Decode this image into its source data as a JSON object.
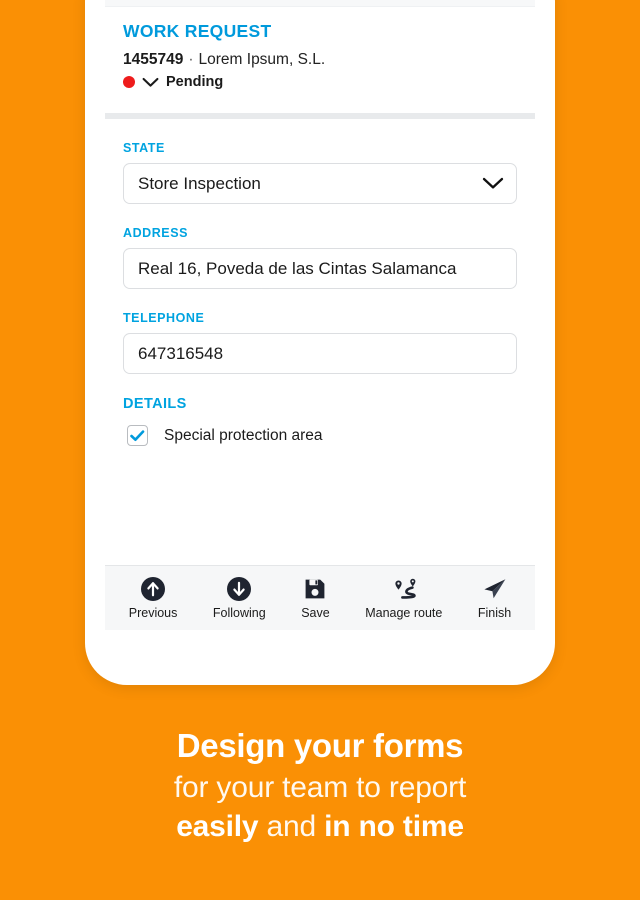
{
  "theme": {
    "background_orange": "#FA9005",
    "accent_blue": "#00A3E0",
    "status_red": "#EE1C1C",
    "text_dark": "#1b1b1b"
  },
  "screen": {
    "header": {
      "title": "WORK REQUEST",
      "reference_id": "1455749",
      "separator": "·",
      "company": "Lorem Ipsum, S.L.",
      "status": "Pending"
    },
    "form": {
      "fields": [
        {
          "label": "STATE",
          "value": "Store Inspection",
          "type": "select"
        },
        {
          "label": "ADDRESS",
          "value": "Real 16, Poveda de las Cintas Salamanca",
          "type": "text"
        },
        {
          "label": "TELEPHONE",
          "value": "647316548",
          "type": "text"
        }
      ],
      "details": {
        "label": "DETAILS",
        "checkbox_label": "Special protection area",
        "checked": true
      }
    },
    "toolbar": {
      "items": [
        {
          "label": "Previous",
          "icon": "arrow-up-circle-icon"
        },
        {
          "label": "Following",
          "icon": "arrow-down-circle-icon"
        },
        {
          "label": "Save",
          "icon": "floppy-disk-icon"
        },
        {
          "label": "Manage route",
          "icon": "route-pin-icon"
        },
        {
          "label": "Finish",
          "icon": "paper-plane-icon"
        }
      ]
    }
  },
  "marketing": {
    "line1": "Design your forms",
    "line2": "for your team to report",
    "line3_part1": "easily",
    "line3_part2": " and ",
    "line3_part3": "in no time"
  }
}
